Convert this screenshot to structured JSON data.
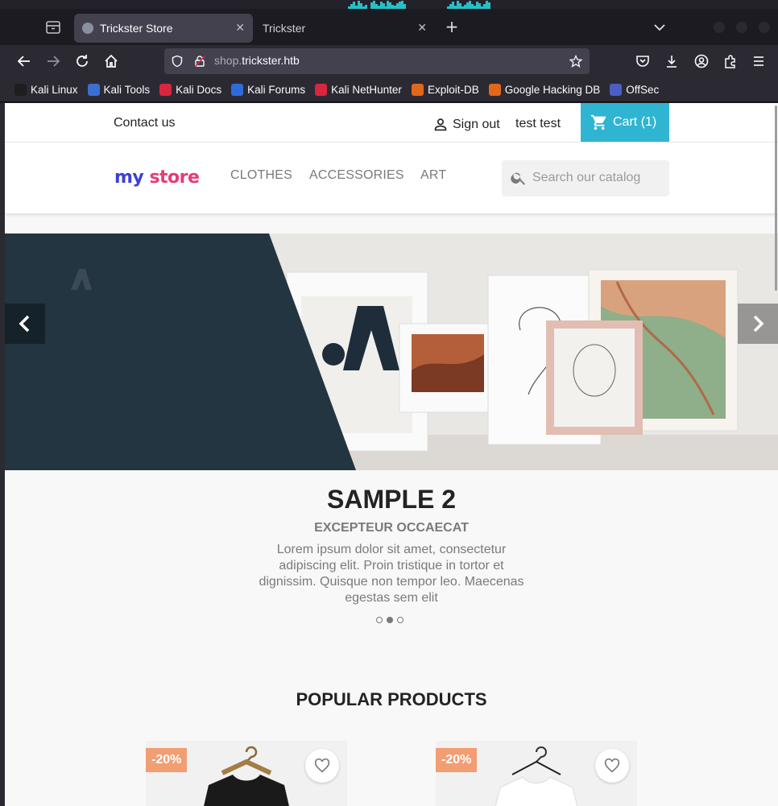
{
  "browser": {
    "tabs": [
      {
        "title": "Trickster Store",
        "active": true
      },
      {
        "title": "Trickster",
        "active": false
      }
    ],
    "url": {
      "subdomain": "shop.",
      "domain": "trickster.htb"
    },
    "bookmarks": [
      {
        "label": "Kali Linux",
        "color": "#1e1e1e"
      },
      {
        "label": "Kali Tools",
        "color": "#3b6fd1"
      },
      {
        "label": "Kali Docs",
        "color": "#d7263d"
      },
      {
        "label": "Kali Forums",
        "color": "#2f6bd8"
      },
      {
        "label": "Kali NetHunter",
        "color": "#d7263d"
      },
      {
        "label": "Exploit-DB",
        "color": "#e0681b"
      },
      {
        "label": "Google Hacking DB",
        "color": "#e0681b"
      },
      {
        "label": "OffSec",
        "color": "#4b5fc2"
      }
    ]
  },
  "store": {
    "contact": "Contact us",
    "sign_out": "Sign out",
    "user": "test test",
    "cart": "Cart",
    "cart_count": "(1)",
    "logo_left": "my",
    "logo_right": "store",
    "menu": [
      "CLOTHES",
      "ACCESSORIES",
      "ART"
    ],
    "search_placeholder": "Search our catalog",
    "accent": "#2fb5d2"
  },
  "slide": {
    "title": "SAMPLE 2",
    "subtitle": "EXCEPTEUR OCCAECAT",
    "text": "Lorem ipsum dolor sit amet, consectetur adipiscing elit. Proin tristique in tortor et dignissim. Quisque non tempor leo. Maecenas egestas sem elit",
    "dots": 3,
    "active_dot": 2
  },
  "popular": {
    "title": "POPULAR PRODUCTS",
    "products": [
      {
        "badge": "-20%",
        "shirt": "black"
      },
      {
        "badge": "-20%",
        "shirt": "white"
      }
    ]
  }
}
